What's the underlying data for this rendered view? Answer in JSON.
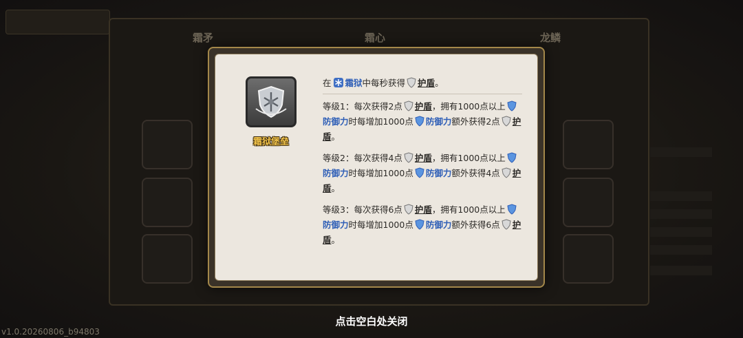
{
  "background": {
    "tabs": [
      "霜矛",
      "霜心",
      "龙鳞"
    ],
    "version": "v1.0.20260806_b94803"
  },
  "skill": {
    "name": "霜狱堡垒",
    "icon": "frost-shield-icon"
  },
  "description": {
    "head": {
      "prefix": "在",
      "zone_icon": "frost-snowflake-icon",
      "zone": "霜狱",
      "middle": "中每秒获得",
      "shield_icon": "silver-shield-icon",
      "shield": "护盾",
      "suffix": "。"
    },
    "levels": [
      {
        "label": "等级1：",
        "text1": "每次获得2点",
        "shield": "护盾",
        "text2": "，拥有1000点以上",
        "defense": "防御力",
        "text3": "时每增加1000点",
        "defense2": "防御力",
        "text4": "额外获得2点",
        "shield2": "护盾",
        "end": "。"
      },
      {
        "label": "等级2：",
        "text1": "每次获得4点",
        "shield": "护盾",
        "text2": "，拥有1000点以上",
        "defense": "防御力",
        "text3": "时每增加1000点",
        "defense2": "防御力",
        "text4": "额外获得4点",
        "shield2": "护盾",
        "end": "。"
      },
      {
        "label": "等级3：",
        "text1": "每次获得6点",
        "shield": "护盾",
        "text2": "，拥有1000点以上",
        "defense": "防御力",
        "text3": "时每增加1000点",
        "defense2": "防御力",
        "text4": "额外获得6点",
        "shield2": "护盾",
        "end": "。"
      }
    ]
  },
  "close_hint": "点击空白处关闭",
  "colors": {
    "keyword_blue": "#2f5fb7",
    "name_gold": "#f0c24a",
    "modal_border": "#a4884a"
  }
}
